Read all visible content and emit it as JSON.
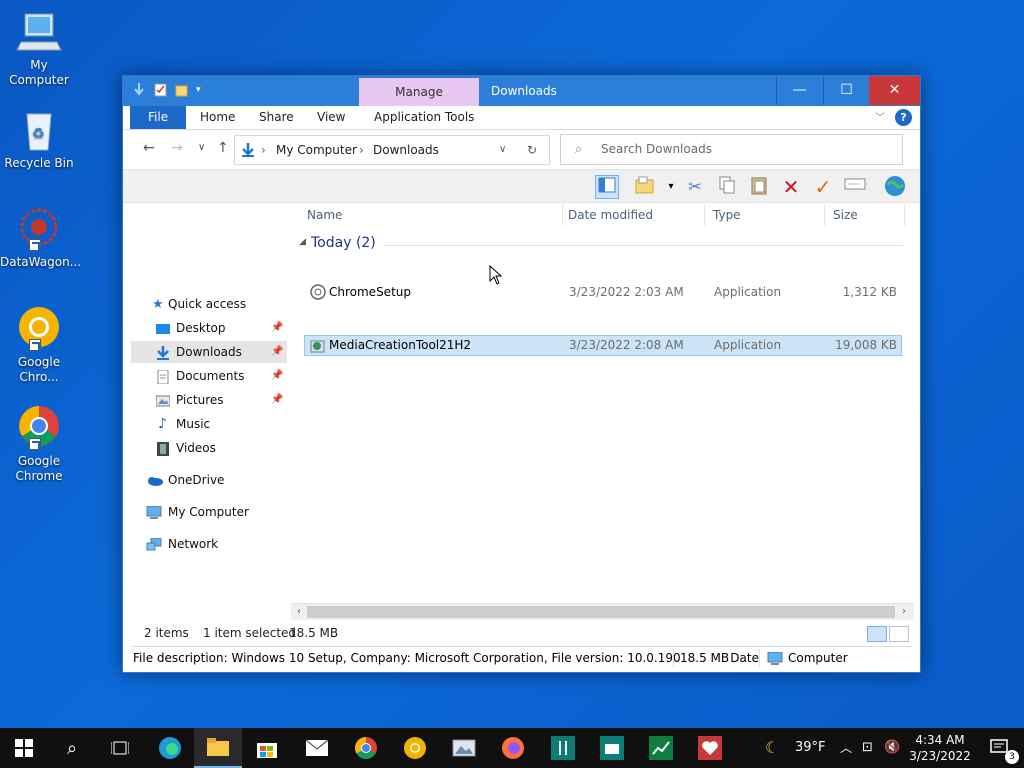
{
  "desktop": {
    "icons": [
      {
        "label": "My Computer"
      },
      {
        "label": "Recycle Bin"
      },
      {
        "label": "DataWagon..."
      },
      {
        "label": "Google\nChro..."
      },
      {
        "label": "Google\nChrome"
      }
    ]
  },
  "window": {
    "title": "Downloads",
    "manage_tab": "Manage",
    "ribbon_tabs": [
      "File",
      "Home",
      "Share",
      "View",
      "Application Tools"
    ],
    "help": "?",
    "address": {
      "crumbs": [
        "My Computer",
        "Downloads"
      ]
    },
    "search": {
      "placeholder": "Search Downloads"
    },
    "nav": {
      "quick_access": "Quick access",
      "items": [
        "Desktop",
        "Downloads",
        "Documents",
        "Pictures",
        "Music",
        "Videos"
      ],
      "onedrive": "OneDrive",
      "my_computer": "My Computer",
      "network": "Network"
    },
    "columns": [
      "Name",
      "Date modified",
      "Type",
      "Size"
    ],
    "group": "Today (2)",
    "files": [
      {
        "name": "MediaCreationTool21H2",
        "date": "3/23/2022 2:08 AM",
        "type": "Application",
        "size": "19,008 KB"
      },
      {
        "name": "ChromeSetup",
        "date": "3/23/2022 2:03 AM",
        "type": "Application",
        "size": "1,312 KB"
      }
    ],
    "status": {
      "count": "2 items",
      "selected": "1 item selected",
      "size": "18.5 MB"
    },
    "details": {
      "description": "File description: Windows 10 Setup, Company: Microsoft Corporation, File version: 10.0.19041.572, Date",
      "size": "18.5 MB",
      "location": "Computer"
    }
  },
  "taskbar": {
    "weather": "39°F",
    "time": "4:34 AM",
    "date": "3/23/2022",
    "notifications": "3"
  },
  "colors": {
    "accent": "#2c7fd8",
    "close": "#c8373a",
    "manage": "#e6c8f0",
    "selection": "#cce4f7"
  }
}
